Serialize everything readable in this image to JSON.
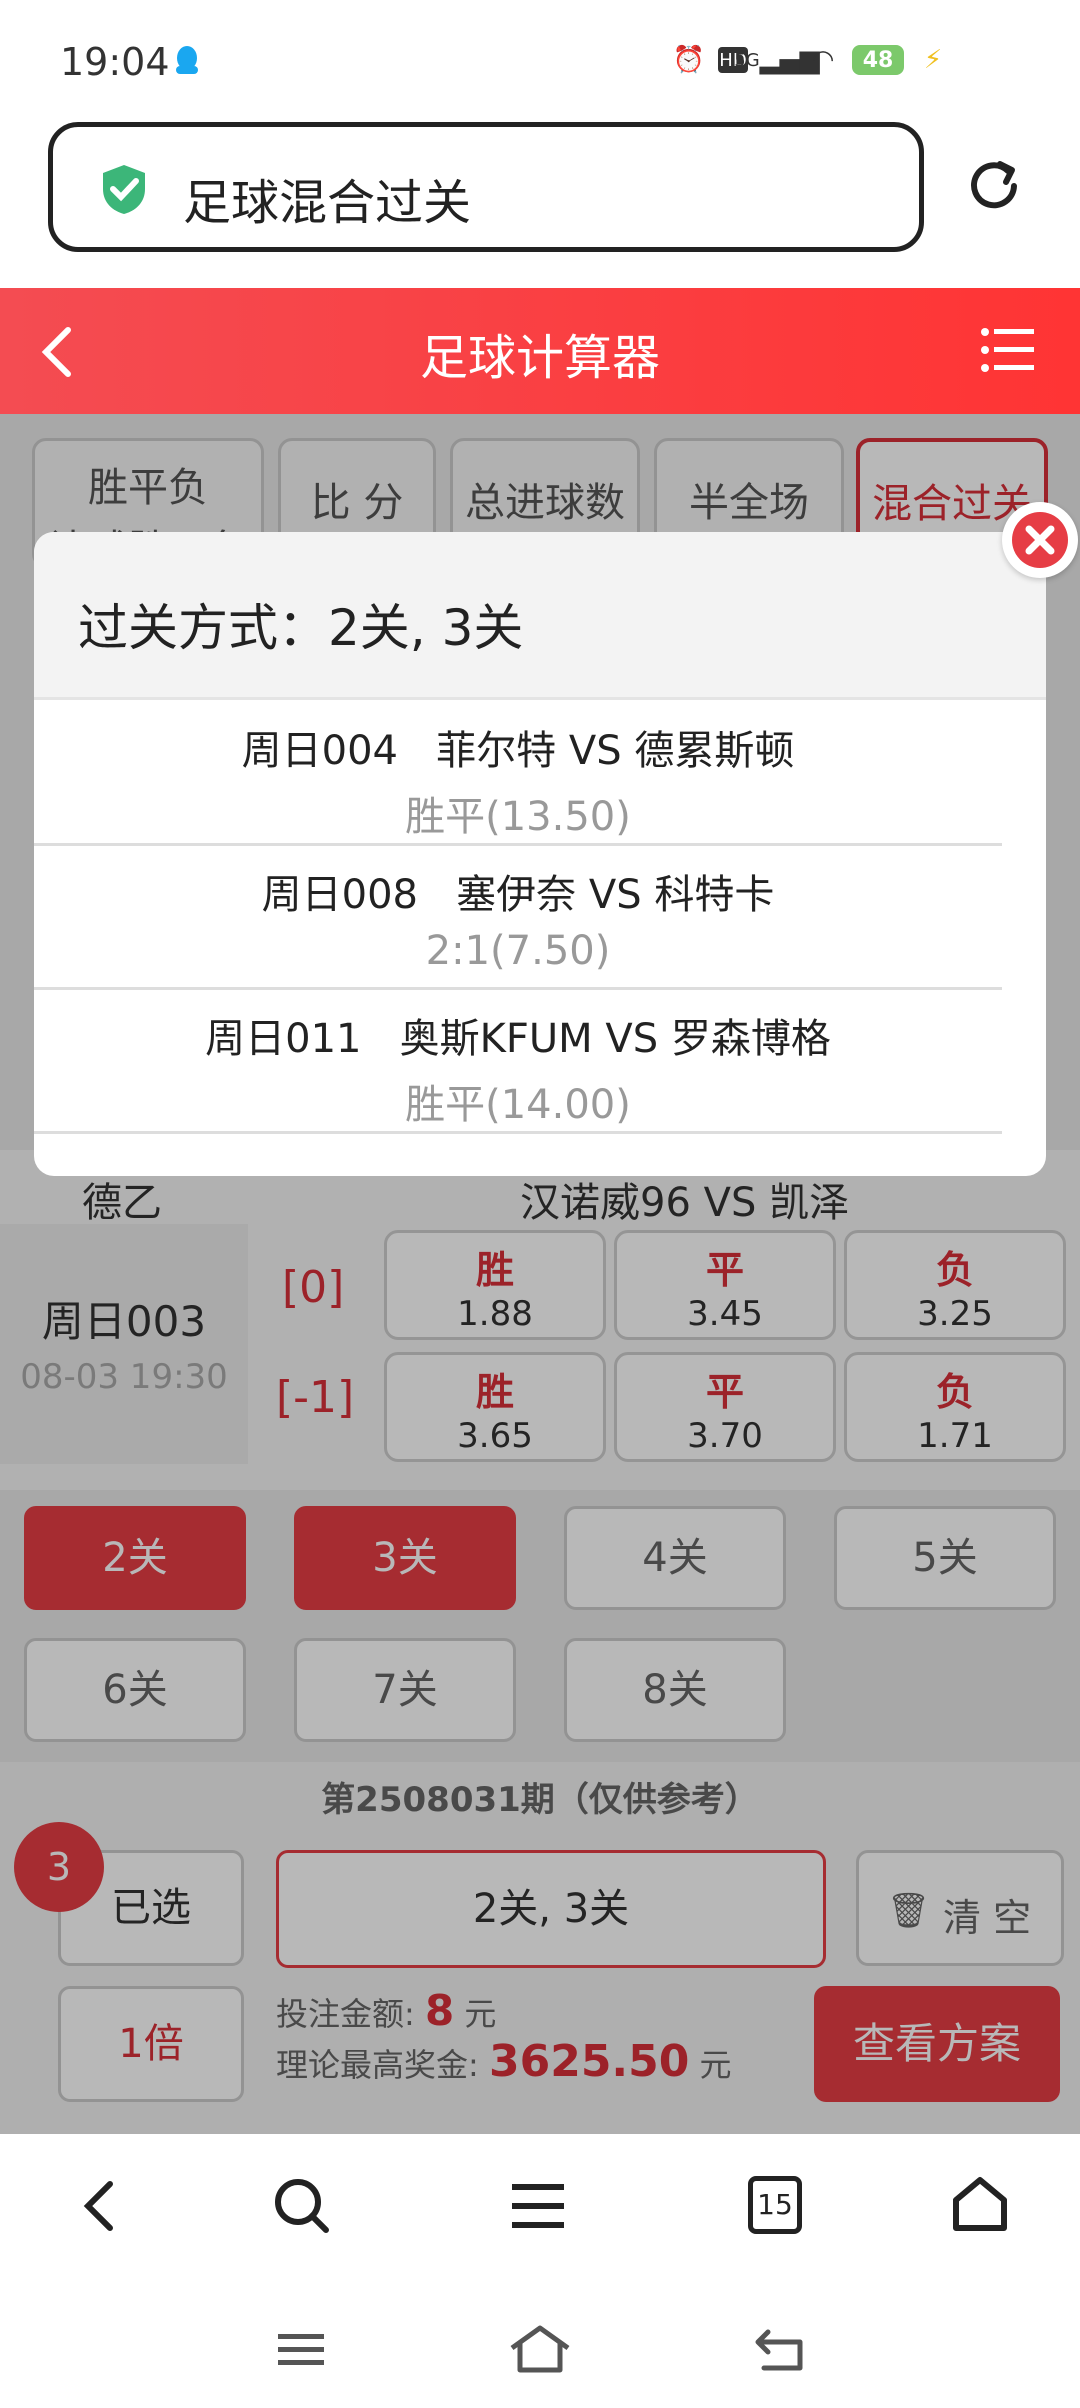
{
  "status": {
    "time": "19:04",
    "network": "5G",
    "battery": "48"
  },
  "browser": {
    "url_title": "足球混合过关"
  },
  "header": {
    "title": "足球计算器"
  },
  "tabs": [
    {
      "label": "胜平负",
      "sub": "让球胜平负"
    },
    {
      "label": "比 分"
    },
    {
      "label": "总进球数"
    },
    {
      "label": "半全场"
    },
    {
      "label": "混合过关"
    }
  ],
  "match": {
    "league": "德乙",
    "teams": "汉诺威96 VS 凯泽",
    "code": "周日003",
    "datetime": "08-03 19:30",
    "rows": [
      {
        "handicap": "[0]",
        "odds": [
          {
            "label": "胜",
            "value": "1.88"
          },
          {
            "label": "平",
            "value": "3.45"
          },
          {
            "label": "负",
            "value": "3.25"
          }
        ]
      },
      {
        "handicap": "[-1]",
        "odds": [
          {
            "label": "胜",
            "value": "3.65"
          },
          {
            "label": "平",
            "value": "3.70"
          },
          {
            "label": "负",
            "value": "1.71"
          }
        ]
      }
    ]
  },
  "pass_options": [
    {
      "label": "2关",
      "selected": true
    },
    {
      "label": "3关",
      "selected": true
    },
    {
      "label": "4关",
      "selected": false
    },
    {
      "label": "5关",
      "selected": false
    },
    {
      "label": "6关",
      "selected": false
    },
    {
      "label": "7关",
      "selected": false
    },
    {
      "label": "8关",
      "selected": false
    }
  ],
  "summary": {
    "period": "第2508031期（仅供参考）",
    "count": "3",
    "selected_label": "已选",
    "pass_types": "2关, 3关",
    "clear_label": "清 空",
    "multiplier": "1倍",
    "bet_label": "投注金额:",
    "bet_amount": "8",
    "bet_unit": "元",
    "max_label": "理论最高奖金:",
    "max_amount": "3625.50",
    "max_unit": "元",
    "view_button": "查看方案"
  },
  "modal": {
    "title": "过关方式：2关, 3关",
    "items": [
      {
        "match": "周日004   菲尔特 VS 德累斯顿",
        "pick": "胜平(13.50)"
      },
      {
        "match": "周日008   塞伊奈 VS 科特卡",
        "pick": "2:1(7.50)"
      },
      {
        "match": "周日011   奥斯KFUM VS 罗森博格",
        "pick": "胜平(14.00)"
      }
    ]
  },
  "bottom_nav": {
    "tabs_count": "15"
  },
  "colors": {
    "accent": "#e63d45",
    "header": "#f44c52"
  }
}
